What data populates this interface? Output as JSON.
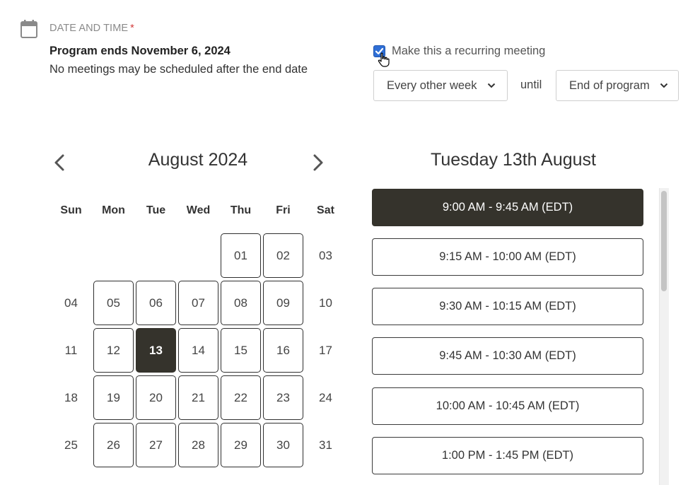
{
  "header": {
    "title": "DATE AND TIME",
    "required_mark": "*",
    "program_end": "Program ends November 6, 2024",
    "program_note": "No meetings may be scheduled after the end date"
  },
  "recurring": {
    "checked": true,
    "label": "Make this a recurring meeting",
    "frequency": "Every other week",
    "until_label": "until",
    "end": "End of program"
  },
  "calendar": {
    "month_label": "August 2024",
    "weekdays": [
      "Sun",
      "Mon",
      "Tue",
      "Wed",
      "Thu",
      "Fri",
      "Sat"
    ],
    "selected_day": "13",
    "weeks": [
      [
        "",
        "",
        "",
        "",
        "01",
        "02",
        "03"
      ],
      [
        "04",
        "05",
        "06",
        "07",
        "08",
        "09",
        "10"
      ],
      [
        "11",
        "12",
        "13",
        "14",
        "15",
        "16",
        "17"
      ],
      [
        "18",
        "19",
        "20",
        "21",
        "22",
        "23",
        "24"
      ],
      [
        "25",
        "26",
        "27",
        "28",
        "29",
        "30",
        "31"
      ]
    ]
  },
  "slots": {
    "date_label": "Tuesday 13th August",
    "selected_index": 0,
    "items": [
      "9:00 AM - 9:45 AM (EDT)",
      "9:15 AM - 10:00 AM (EDT)",
      "9:30 AM - 10:15 AM (EDT)",
      "9:45 AM - 10:30 AM (EDT)",
      "10:00 AM - 10:45 AM (EDT)",
      "1:00 PM - 1:45 PM (EDT)"
    ]
  },
  "colors": {
    "selected": "#35332c",
    "checkbox": "#2f6fd6",
    "required": "#d23b3b"
  },
  "icons": {
    "calendar": "calendar-icon",
    "prev": "chevron-left-icon",
    "next": "chevron-right-icon",
    "dropdown": "chevron-down-icon",
    "cursor": "hand-pointer-icon"
  }
}
